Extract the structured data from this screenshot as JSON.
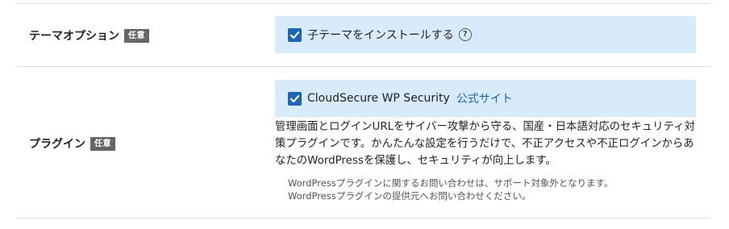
{
  "theme_option": {
    "label": "テーマオプション",
    "badge": "任意",
    "checkbox_label": "子テーマをインストールする",
    "checked": true,
    "help_icon": "question-circle-icon"
  },
  "plugin": {
    "label": "プラグイン",
    "badge": "任意",
    "checkbox_label": "CloudSecure WP Security",
    "checked": true,
    "link_text": "公式サイト",
    "description": "管理画面とログインURLをサイバー攻撃から守る、国産・日本語対応のセキュリティ対策プラグインです。かんたんな設定を行うだけで、不正アクセスや不正ログインからあなたのWordPressを保護し、セキュリティが向上します。",
    "note_line1": "WordPressプラグインに関するお問い合わせは、サポート対象外となります。",
    "note_line2": "WordPressプラグインの提供元へお問い合わせください。"
  },
  "colors": {
    "option_bg": "#d8ebfb",
    "checkbox": "#1e66b8",
    "link": "#1a63b5",
    "badge_bg": "#666666"
  }
}
